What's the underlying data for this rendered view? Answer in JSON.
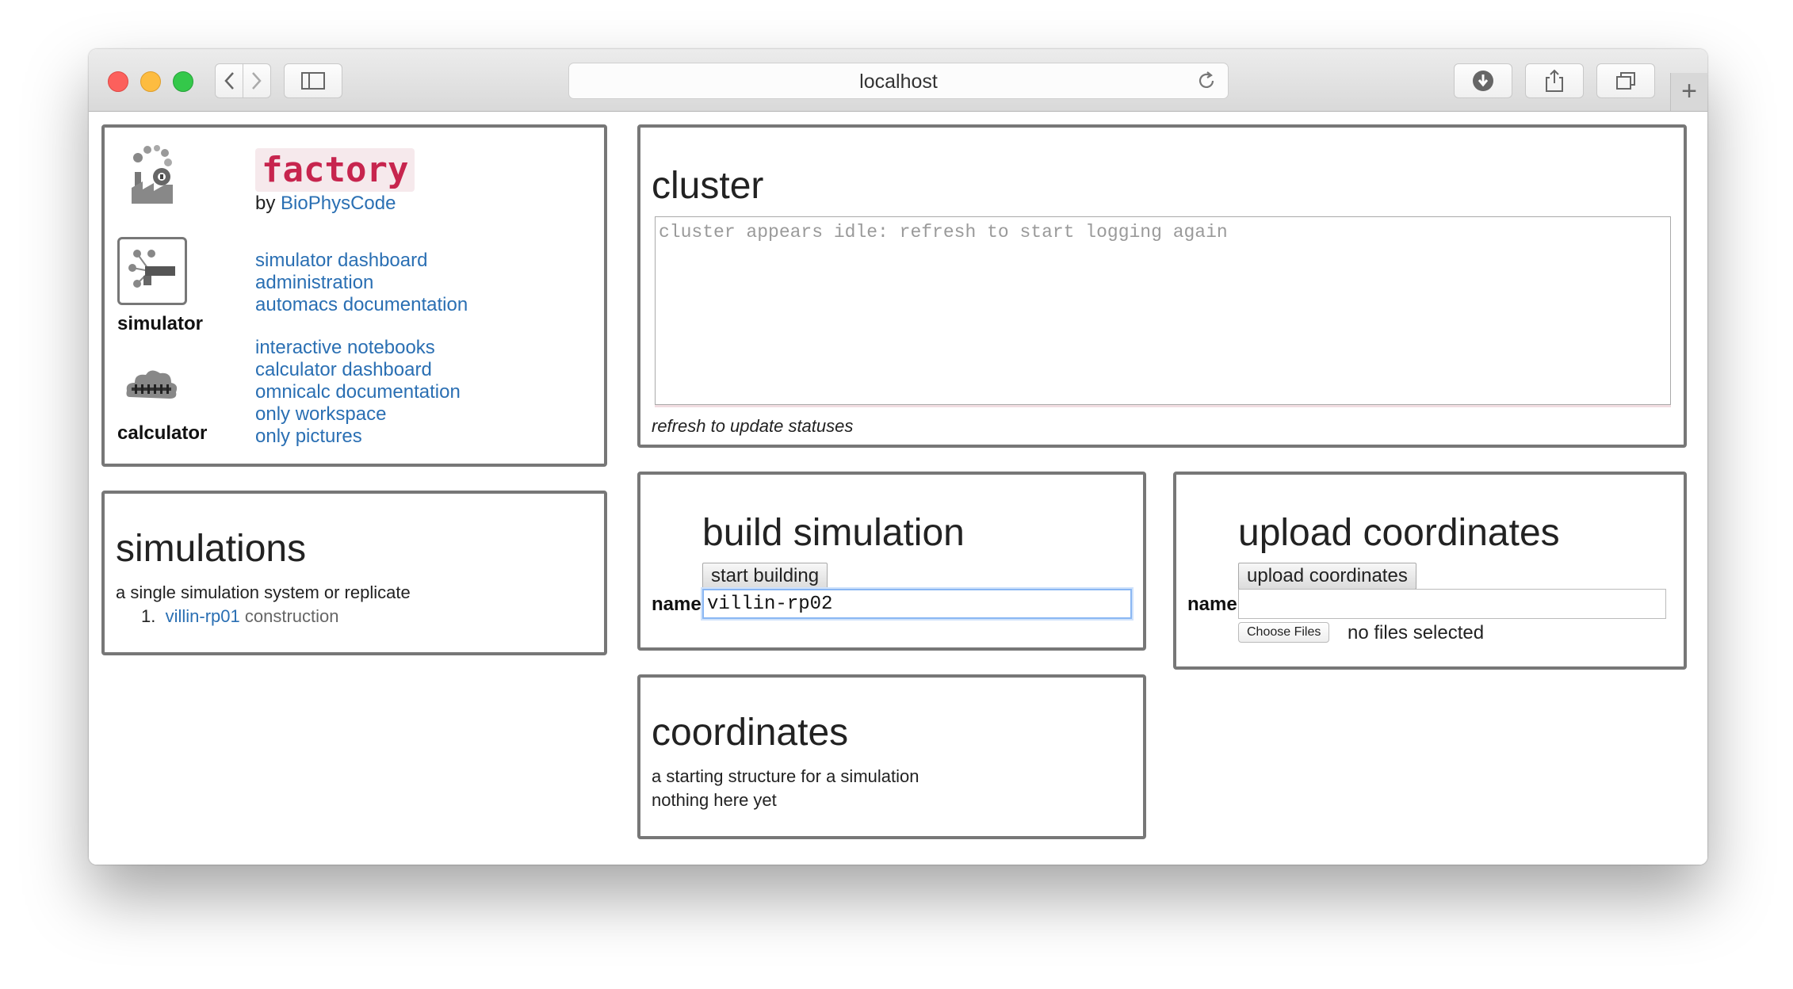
{
  "browser": {
    "url": "localhost"
  },
  "brand": {
    "name": "factory",
    "by_prefix": "by",
    "by_link": "BioPhysCode"
  },
  "simulator": {
    "label": "simulator",
    "links": [
      "simulator dashboard",
      "administration",
      "automacs documentation"
    ]
  },
  "calculator": {
    "label": "calculator",
    "links": [
      "interactive notebooks",
      "calculator dashboard",
      "omnicalc documentation",
      "only workspace",
      "only pictures"
    ]
  },
  "simulations": {
    "title": "simulations",
    "description": "a single simulation system or replicate",
    "items": [
      {
        "index": "1.",
        "name": "villin-rp01",
        "status": "construction"
      }
    ]
  },
  "cluster": {
    "title": "cluster",
    "log_text": "cluster appears idle: refresh to start logging again",
    "note": "refresh to update statuses"
  },
  "build": {
    "title": "build simulation",
    "button": "start building",
    "name_label": "name",
    "name_value": "villin-rp02"
  },
  "upload": {
    "title": "upload coordinates",
    "button": "upload coordinates",
    "name_label": "name",
    "name_value": "",
    "choose_button": "Choose Files",
    "files_status": "no files selected"
  },
  "coordinates": {
    "title": "coordinates",
    "description": "a starting structure for a simulation",
    "empty_text": "nothing here yet"
  }
}
